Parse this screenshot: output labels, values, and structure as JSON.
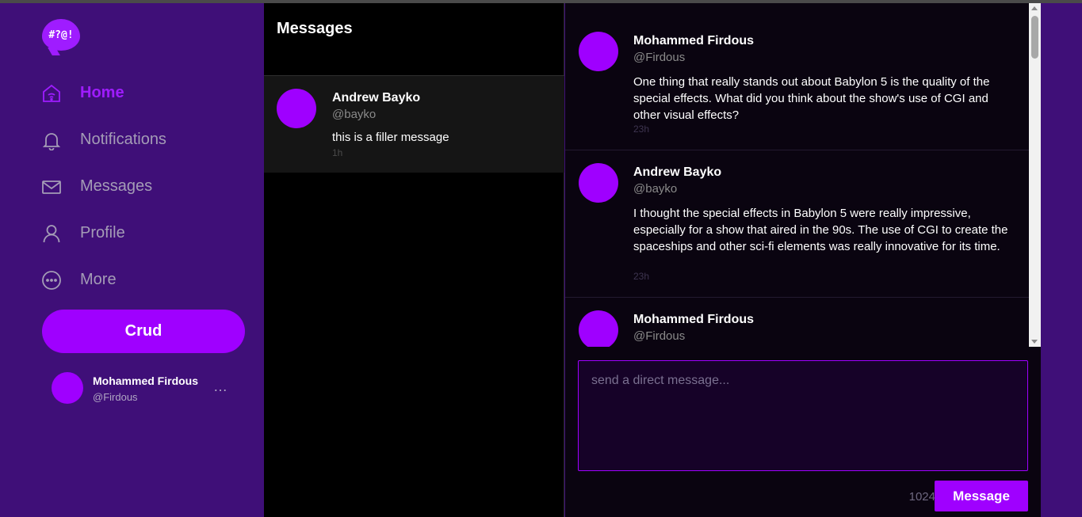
{
  "app": {
    "logo_text": "#?@!"
  },
  "sidebar": {
    "nav": [
      {
        "label": "Home",
        "icon": "home-icon",
        "active": true
      },
      {
        "label": "Notifications",
        "icon": "bell-icon",
        "active": false
      },
      {
        "label": "Messages",
        "icon": "envelope-icon",
        "active": false
      },
      {
        "label": "Profile",
        "icon": "user-icon",
        "active": false
      },
      {
        "label": "More",
        "icon": "more-circle-icon",
        "active": false
      }
    ],
    "crud_button": "Crud",
    "current_user": {
      "name": "Mohammed Firdous",
      "handle": "@Firdous",
      "menu": "…"
    }
  },
  "message_list": {
    "title": "Messages",
    "conversations": [
      {
        "name": "Andrew Bayko",
        "handle": "@bayko",
        "preview": "this is a filler message",
        "time": "1h"
      }
    ]
  },
  "chat": {
    "posts": [
      {
        "name": "Mohammed Firdous",
        "handle": "@Firdous",
        "body": "One thing that really stands out about Babylon 5 is the quality of the special effects. What did you think about the show's use of CGI and other visual effects?",
        "time": "23h"
      },
      {
        "name": "Andrew Bayko",
        "handle": "@bayko",
        "body": "I thought the special effects in Babylon 5 were really impressive, especially for a show that aired in the 90s. The use of CGI to create the spaceships and other sci-fi elements was really innovative for its time.",
        "time": "23h"
      },
      {
        "name": "Mohammed Firdous",
        "handle": "@Firdous"
      }
    ],
    "composer": {
      "placeholder": "send a direct message...",
      "value": "",
      "char_count": "1024",
      "send_label": "Message"
    }
  },
  "colors": {
    "accent": "#9f00ff",
    "sidebar_bg": "#3f0f78",
    "chat_bg": "#0a0410"
  }
}
